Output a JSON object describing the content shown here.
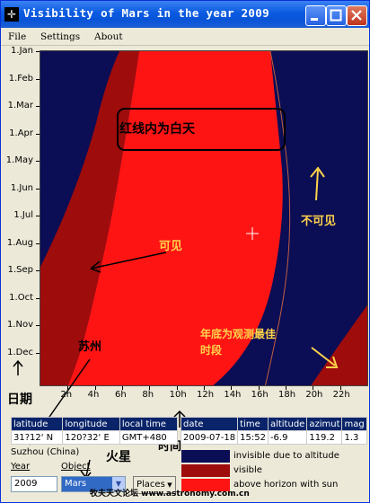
{
  "window": {
    "title": "Visibility of Mars in the year 2009"
  },
  "menu": {
    "file": "File",
    "settings": "Settings",
    "about": "About"
  },
  "chart_data": {
    "type": "area",
    "y_ticks": [
      "1.Jan",
      "1.Feb",
      "1.Mar",
      "1.Apr",
      "1.May",
      "1.Jun",
      "1.Jul",
      "1.Aug",
      "1.Sep",
      "1.Oct",
      "1.Nov",
      "1.Dec"
    ],
    "x_ticks": [
      "2h",
      "4h",
      "6h",
      "8h",
      "10h",
      "12h",
      "14h",
      "16h",
      "18h",
      "20h",
      "22h"
    ],
    "x_range": [
      0,
      24
    ]
  },
  "colors": {
    "invisible": "#0b0d55",
    "visible": "#9e0c0c",
    "above": "#ff1414",
    "tip": "#ffd24a"
  },
  "observer": {
    "headers": [
      "latitude",
      "longitude",
      "local time"
    ],
    "values": [
      "31?12' N",
      "120?32' E",
      "GMT+480"
    ]
  },
  "mars_info": {
    "headers": [
      "date",
      "time",
      "altitude",
      "azimut",
      "mag"
    ],
    "values": [
      "2009-07-18",
      "15:52",
      "-6.9",
      "119.2",
      "1.3"
    ]
  },
  "location": {
    "name": "Suzhou (China)"
  },
  "controls": {
    "year_label": "Year",
    "object_label": "Object",
    "year_value": "2009",
    "object_value": "Mars",
    "places": "Places"
  },
  "legend": {
    "invisible": "invisible due to altitude",
    "visible": "visible",
    "above": "above horizon with sun"
  },
  "annotations": {
    "daytime": "红线内为白天",
    "visible": "可见",
    "invisible": "不可见",
    "best1": "年底为观测最佳",
    "best2": "时段",
    "suzhou": "苏州",
    "date": "日期",
    "time": "时间",
    "mars": "火星",
    "watermark": "牧夫天文论坛 www.astronomy.com.cn"
  }
}
